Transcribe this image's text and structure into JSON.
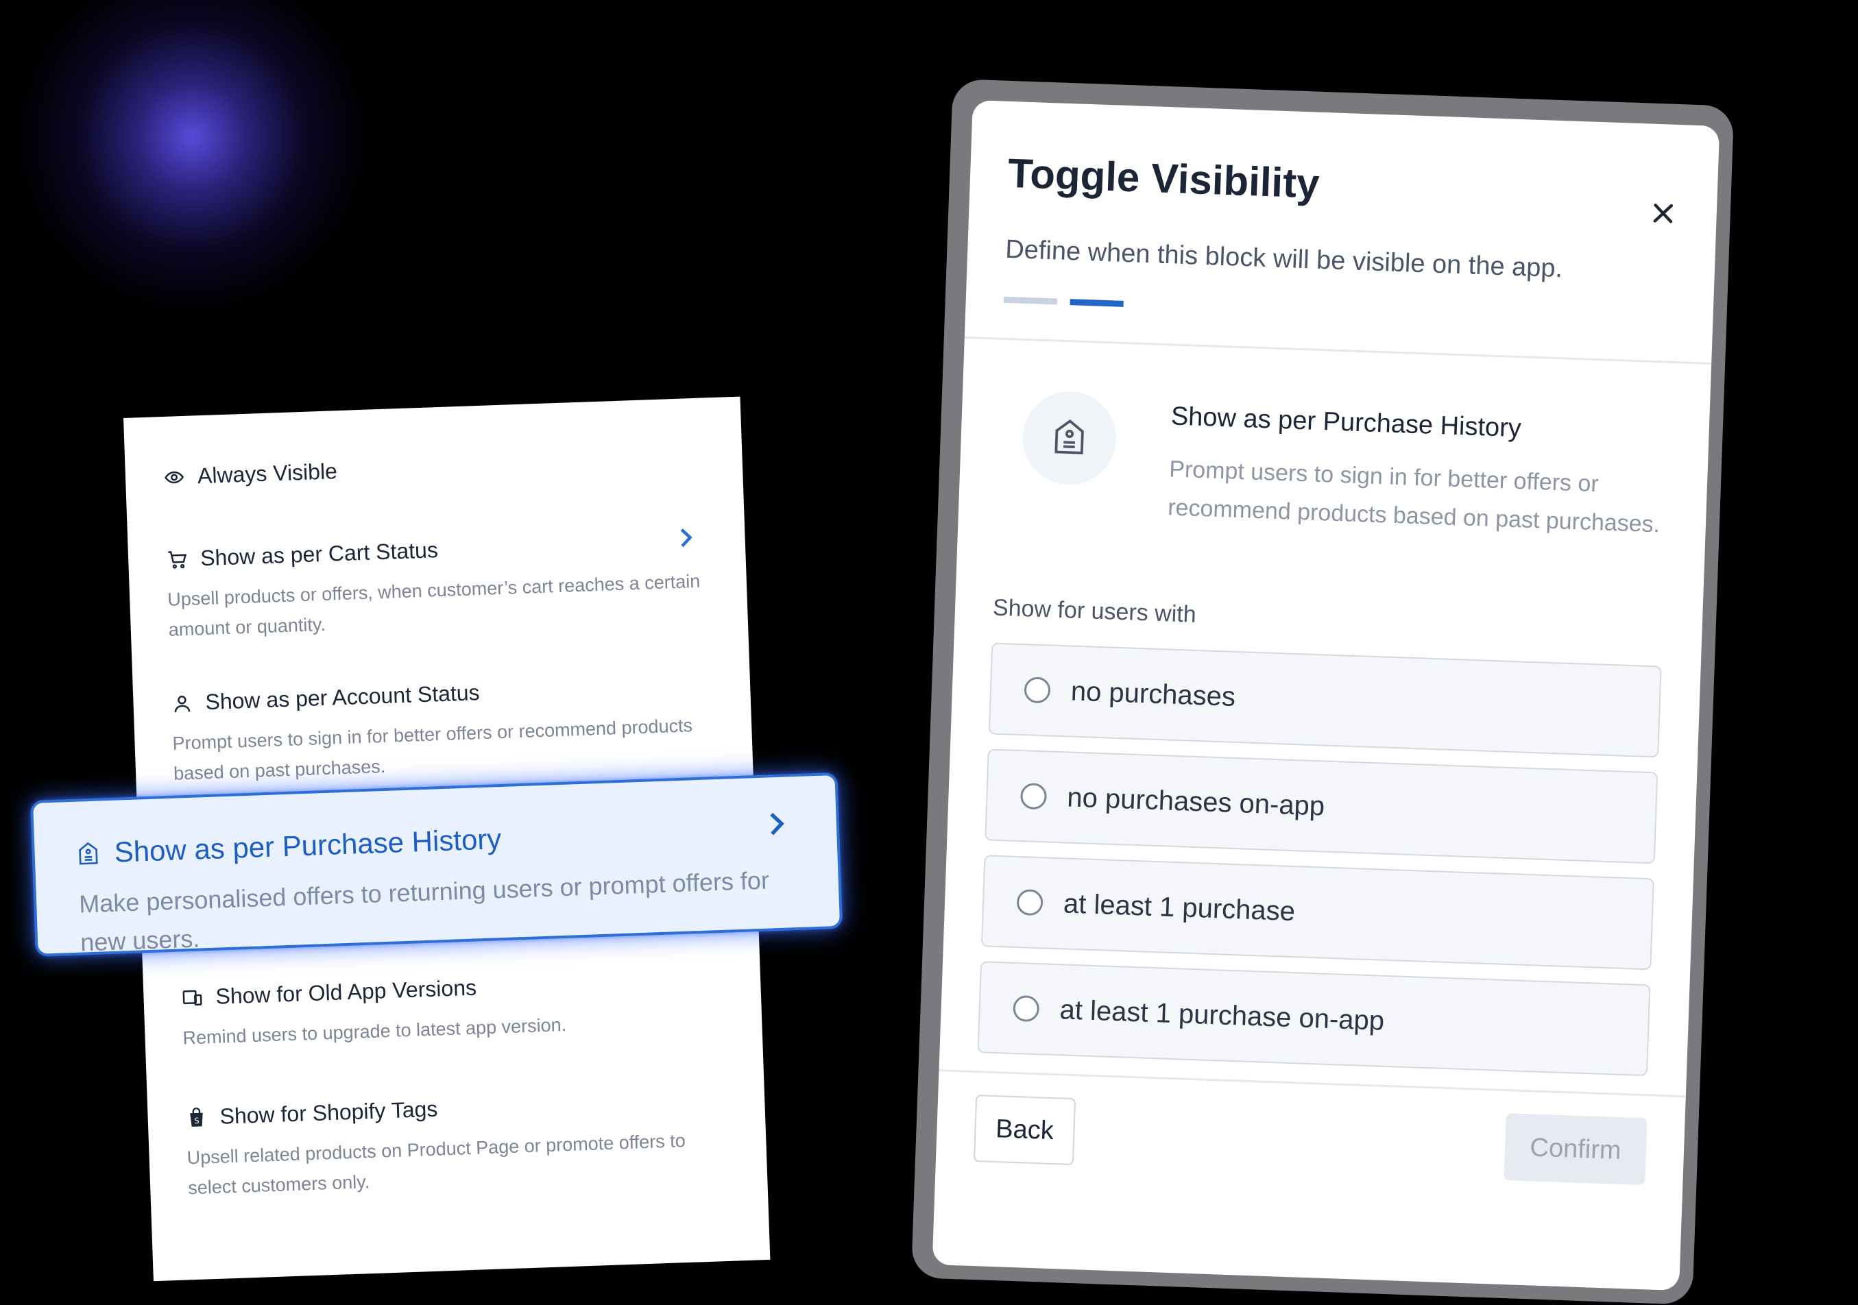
{
  "list": {
    "always_visible": {
      "title": "Always Visible",
      "icon": "eye-icon"
    },
    "cart_status": {
      "title": "Show as per Cart Status",
      "description": "Upsell products or offers, when customer’s cart reaches a certain amount or quantity.",
      "icon": "cart-icon"
    },
    "account_status": {
      "title": "Show as per Account Status",
      "description": "Prompt users to sign in for better offers or recommend products based on past purchases.",
      "icon": "user-icon"
    },
    "purchase_history": {
      "title": "Show as per Purchase History",
      "description": "Make personalised offers to returning users or prompt offers for new users.",
      "icon": "tag-icon"
    },
    "old_app_versions": {
      "title": "Show for Old App Versions",
      "description": "Remind users to upgrade to latest app version.",
      "icon": "devices-icon"
    },
    "shopify_tags": {
      "title": "Show for Shopify Tags",
      "description": "Upsell related products on Product Page or promote offers to select customers only.",
      "icon": "shopify-bag-icon"
    }
  },
  "modal": {
    "title": "Toggle Visibility",
    "subtitle": "Define when this block will be visible on the app.",
    "selected": {
      "title": "Show as per Purchase History",
      "description": "Prompt users to sign in for better offers or recommend products based on past purchases."
    },
    "group_label": "Show for users with",
    "options": [
      {
        "label": "no purchases"
      },
      {
        "label": "no purchases on-app"
      },
      {
        "label": "at least 1 purchase"
      },
      {
        "label": "at least 1 purchase on-app"
      }
    ],
    "back_label": "Back",
    "confirm_label": "Confirm"
  },
  "colors": {
    "accent": "#2266c8",
    "highlight_bg": "#e8f1fd",
    "background": "#000000",
    "glow": "#5c4ee6"
  }
}
